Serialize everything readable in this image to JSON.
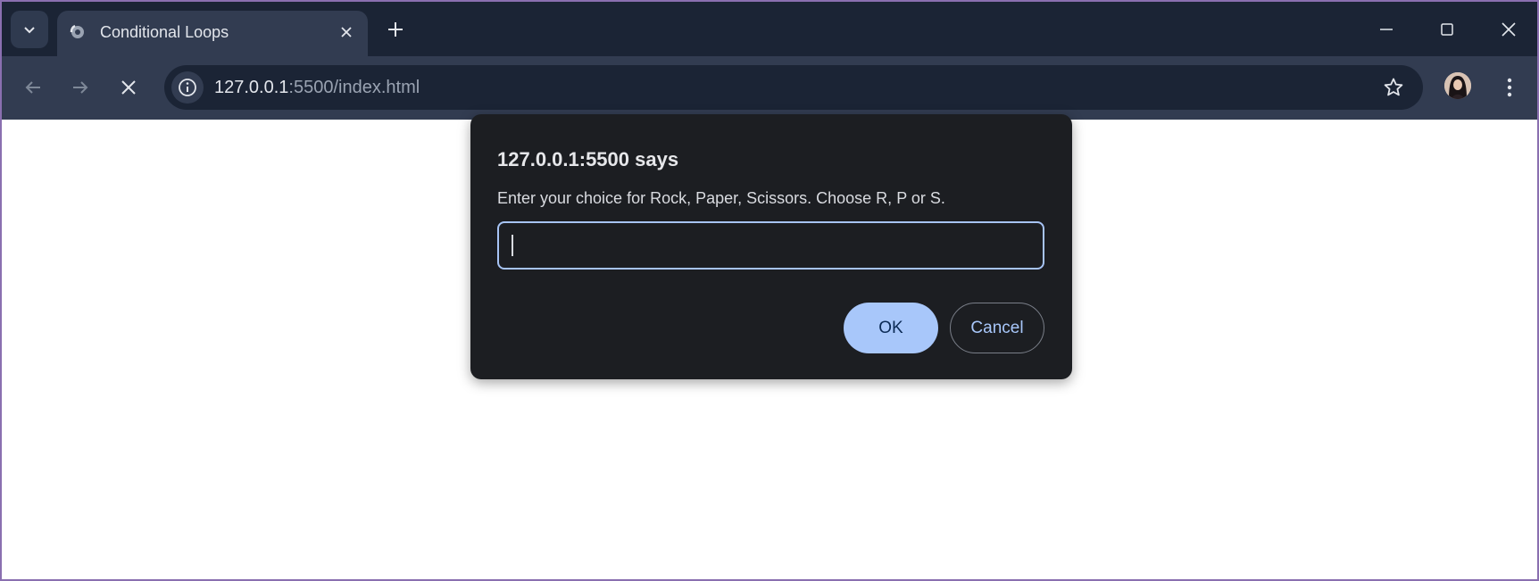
{
  "browser": {
    "tab": {
      "title": "Conditional Loops",
      "favicon": "loading-globe-icon"
    },
    "address_bar": {
      "host": "127.0.0.1",
      "rest": ":5500/index.html"
    },
    "icons": {
      "tab_search": "chevron-down-icon",
      "tab_close": "close-icon",
      "new_tab": "plus-icon",
      "minimize": "minimize-icon",
      "maximize": "maximize-icon",
      "close_window": "close-icon",
      "back": "arrow-left-icon",
      "forward": "arrow-right-icon",
      "stop": "close-icon",
      "site_info": "info-icon",
      "bookmark": "star-icon",
      "menu": "kebab-menu-icon"
    },
    "colors": {
      "frame": "#1b2435",
      "toolbar": "#323c51",
      "accent": "#a8c7fa"
    }
  },
  "dialog": {
    "title": "127.0.0.1:5500 says",
    "message": "Enter your choice for Rock, Paper, Scissors. Choose R, P or S.",
    "input_value": "",
    "ok_label": "OK",
    "cancel_label": "Cancel"
  }
}
